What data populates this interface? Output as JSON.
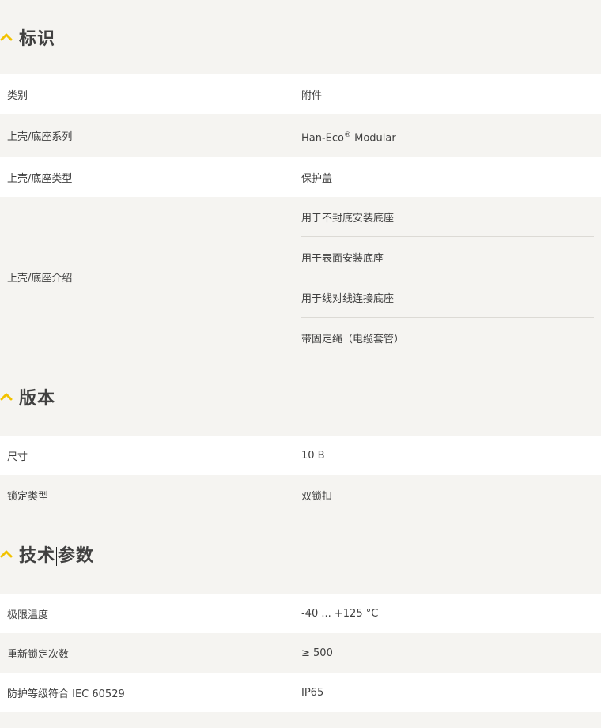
{
  "sections": {
    "identification": {
      "title": "标识",
      "rows": [
        {
          "label": "类别",
          "value": "附件"
        },
        {
          "label": "上壳/底座系列",
          "value_main": "Han-Eco",
          "value_sup": "®",
          "value_tail": " Modular"
        },
        {
          "label": "上壳/底座类型",
          "value": "保护盖"
        }
      ],
      "multi": {
        "label": "上壳/底座介绍",
        "values": [
          "用于不封底安装底座",
          "用于表面安装底座",
          "用于线对线连接底座",
          "带固定绳（电缆套管）"
        ]
      }
    },
    "version": {
      "title": "版本",
      "rows": [
        {
          "label": "尺寸",
          "value": "10 B"
        },
        {
          "label": "锁定类型",
          "value": "双锁扣"
        }
      ]
    },
    "technical": {
      "title_part1": "技术",
      "title_part2": "参数",
      "rows": [
        {
          "label": "极限温度",
          "value": "-40 ... +125 °C"
        },
        {
          "label": "重新锁定次数",
          "value": "≥ 500"
        },
        {
          "label": "防护等级符合 IEC 60529",
          "value": "IP65"
        }
      ]
    }
  },
  "colors": {
    "accent": "#f2c200",
    "background": "#f5f4f1",
    "row_white": "#ffffff"
  },
  "icons": {
    "section_toggle": "chevron-up-icon"
  }
}
